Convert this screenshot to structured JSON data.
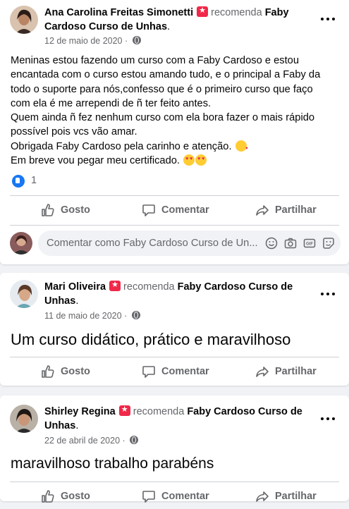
{
  "posts": [
    {
      "author": "Ana Carolina Freitas Simonetti",
      "recommends": "recomenda",
      "page": "Faby Cardoso Curso de Unhas",
      "date": "12 de maio de 2020",
      "separator": "·",
      "lines": [
        "Meninas estou fazendo um curso com a Faby Cardoso e estou",
        "encantada com o curso estou amando tudo, e o principal a Faby da",
        "todo o suporte para nós,confesso que é o primeiro curso que faço",
        "com ela é me arrependi de ñ ter feito antes.",
        "Quem ainda ñ fez nenhum curso com ela bora fazer o mais rápido",
        "possível pois vcs vão amar.",
        "Obrigada Faby Cardoso pela carinho e atenção.",
        "Em breve vou pegar meu certificado."
      ],
      "reaction_count": "1"
    },
    {
      "author": "Mari Oliveira",
      "recommends": "recomenda",
      "page": "Faby Cardoso Curso de Unhas",
      "date": "11 de maio de 2020",
      "separator": "·",
      "text": "Um curso didático, prático e maravilhoso"
    },
    {
      "author": "Shirley Regina",
      "recommends": "recomenda",
      "page": "Faby Cardoso Curso de Unhas",
      "date": "22 de abril de 2020",
      "separator": "·",
      "text": "maravilhoso trabalho parabéns"
    }
  ],
  "actions": {
    "like": "Gosto",
    "comment": "Comentar",
    "share": "Partilhar"
  },
  "comment_box": {
    "placeholder": "Comentar como Faby Cardoso Curso de Un..."
  },
  "colors": {
    "brand_blue": "#1877f2",
    "text_secondary": "#65676b",
    "badge_red": "#f02849"
  }
}
